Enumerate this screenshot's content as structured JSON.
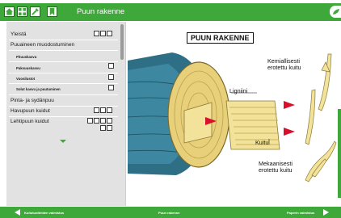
{
  "app": {
    "title": "Puun rakenne"
  },
  "toolbar": {
    "buttons": [
      {
        "name": "home-icon"
      },
      {
        "name": "grid-icon"
      },
      {
        "name": "tools-icon"
      },
      {
        "name": "bookmark-icon"
      }
    ]
  },
  "sidebar": {
    "items": [
      {
        "label": "Yleistä",
        "level": 0
      },
      {
        "label": "Puuaineen muodostuminen",
        "level": 0
      },
      {
        "label": "Pituuskasvu",
        "level": 1
      },
      {
        "label": "Paksuuskasvu",
        "level": 1
      },
      {
        "label": "Vuosilustot",
        "level": 1
      },
      {
        "label": "Solut kasvu ja puutuminen",
        "level": 1
      },
      {
        "label": "Pinta- ja sydänpuu",
        "level": 0
      },
      {
        "label": "Havupuun kuidut",
        "level": 0
      },
      {
        "label": "Lehtipuun kuidut",
        "level": 0
      }
    ]
  },
  "main": {
    "page_title": "PUUN RAKENNE",
    "labels": {
      "chemical": "Kemiallisesti erotettu kuitu",
      "lignin": "Ligniini",
      "fiber": "Kuitu",
      "mechanical": "Mekaanisesti erotettu kuitu"
    }
  },
  "footer": {
    "prev_label": "Kuitutuotteiden valmistus",
    "up_label": "Puun rakenne",
    "next_label": "Paperin valmistus"
  },
  "colors": {
    "accent_green": "#3fa83a",
    "arrow_red": "#d8102a",
    "wood_blue": "#2f6f86",
    "fiber_yellow": "#f2e29a"
  }
}
